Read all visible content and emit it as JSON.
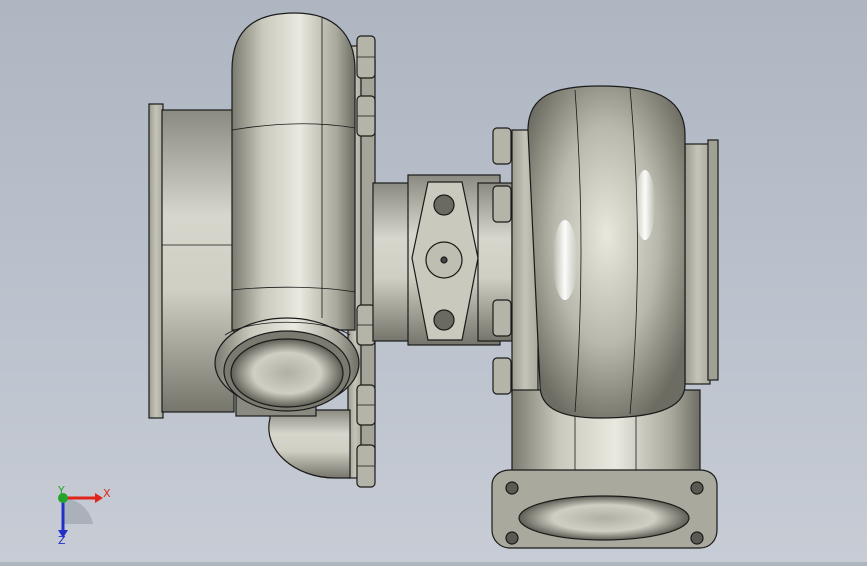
{
  "viewport": {
    "background_top": "#aeb6c2",
    "background_bottom": "#c7ccd5"
  },
  "model": {
    "colors": {
      "metal_light": "#f2f2ea",
      "metal_mid": "#c8c8bc",
      "metal_dark": "#6a6a60",
      "edge": "#1a1a1a"
    }
  },
  "triad": {
    "x_label": "X",
    "y_label": "Y",
    "z_label": "Z",
    "x_color": "#e0261c",
    "y_color": "#22a52a",
    "z_color": "#2330c8"
  }
}
